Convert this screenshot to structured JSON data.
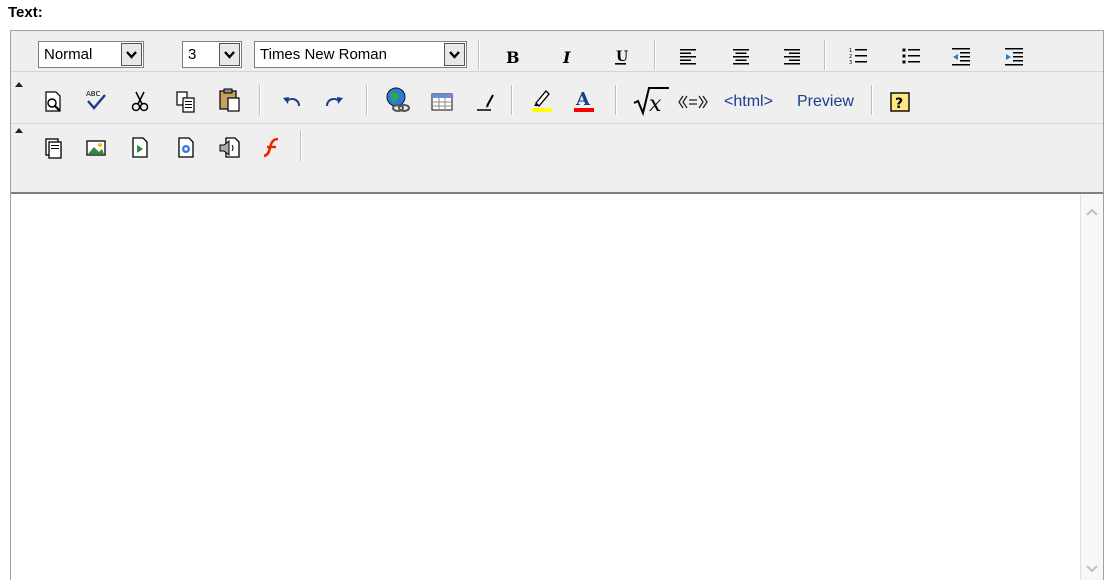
{
  "field_label": "Text:",
  "toolbar": {
    "format_select": "Normal",
    "size_select": "3",
    "font_select": "Times New Roman",
    "html_label": "<html>",
    "preview_label": "Preview"
  },
  "colors": {
    "toolbar_bg": "#efefef",
    "link_text": "#1a3c8c",
    "highlight_yellow": "#ffff00",
    "font_color_red": "#ff0000",
    "flash_red": "#ee2200"
  }
}
